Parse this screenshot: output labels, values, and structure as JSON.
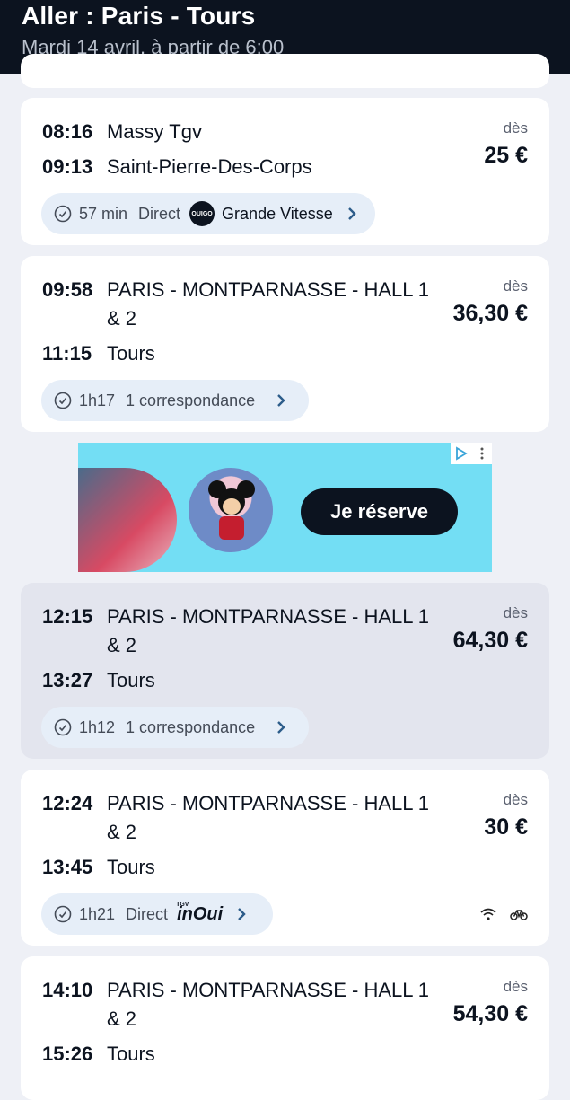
{
  "header": {
    "title": "Aller : Paris - Tours",
    "subtitle": "Mardi 14 avril, à partir de 6:00"
  },
  "journeys": [
    {
      "dep_time": "08:16",
      "dep_station": "Massy Tgv",
      "arr_time": "09:13",
      "arr_station": "Saint-Pierre-Des-Corps",
      "price_label": "dès",
      "price": "25 €",
      "duration": "57 min",
      "type": "Direct",
      "carrier": "Grande Vitesse",
      "carrier_logo": "OUIGO"
    },
    {
      "dep_time": "09:58",
      "dep_station": "PARIS - MONTPARNASSE - HALL 1 & 2",
      "arr_time": "11:15",
      "arr_station": "Tours",
      "price_label": "dès",
      "price": "36,30 €",
      "duration": "1h17",
      "type": "1 correspondance"
    },
    {
      "dep_time": "12:15",
      "dep_station": "PARIS - MONTPARNASSE - HALL 1 & 2",
      "arr_time": "13:27",
      "arr_station": "Tours",
      "price_label": "dès",
      "price": "64,30 €",
      "duration": "1h12",
      "type": "1 correspondance"
    },
    {
      "dep_time": "12:24",
      "dep_station": "PARIS - MONTPARNASSE - HALL 1 & 2",
      "arr_time": "13:45",
      "arr_station": "Tours",
      "price_label": "dès",
      "price": "30 €",
      "duration": "1h21",
      "type": "Direct",
      "carrier_logo_main": "inOui",
      "carrier_logo_small": "TGV",
      "amenities": [
        "wifi-icon",
        "bike-icon"
      ]
    },
    {
      "dep_time": "14:10",
      "dep_station": "PARIS - MONTPARNASSE - HALL 1 & 2",
      "arr_time": "15:26",
      "arr_station": "Tours",
      "price_label": "dès",
      "price": "54,30 €"
    }
  ],
  "ad": {
    "cta": "Je réserve"
  },
  "colors": {
    "header_bg": "#0c131f",
    "page_bg": "#eef0f6",
    "selected_card_bg": "#e3e5ee",
    "pill_bg": "#e6eef8",
    "ad_bg": "#73def4",
    "chevron": "#2c5c8a"
  }
}
